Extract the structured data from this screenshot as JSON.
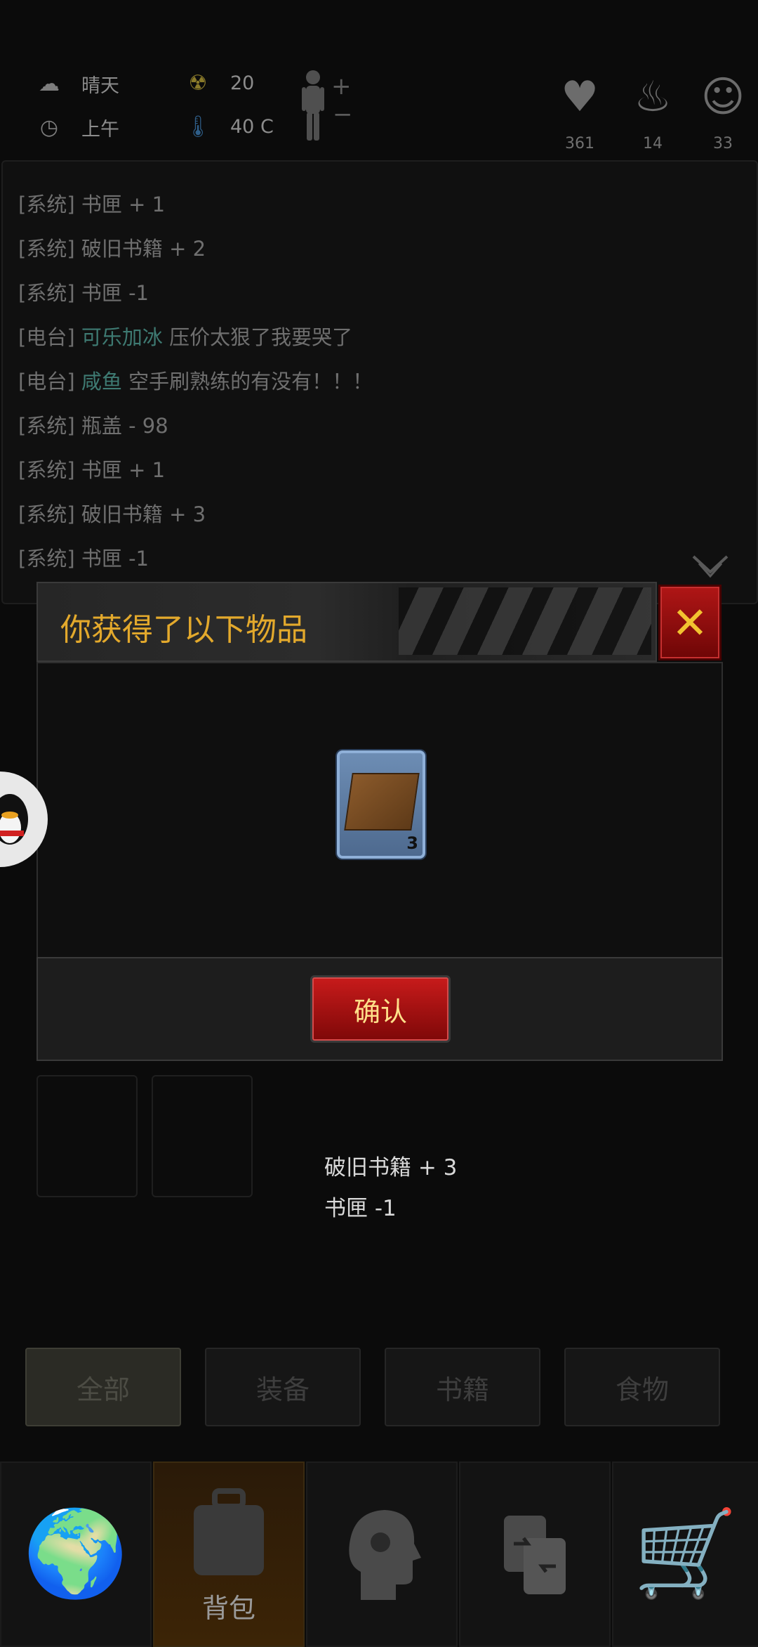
{
  "status": {
    "weather_label": "晴天",
    "time_label": "上午",
    "radiation_value": "20",
    "temperature_value": "40 C",
    "health_value": "361",
    "stamina_value": "14",
    "mind_value": "33"
  },
  "log": [
    {
      "tag": "[系统]",
      "who": "",
      "text": "书匣 + 1"
    },
    {
      "tag": "[系统]",
      "who": "",
      "text": "破旧书籍 + 2"
    },
    {
      "tag": "[系统]",
      "who": "",
      "text": "书匣 -1"
    },
    {
      "tag": "[电台]",
      "who": "可乐加冰",
      "text": "压价太狠了我要哭了"
    },
    {
      "tag": "[电台]",
      "who": "咸鱼",
      "text": "空手刷熟练的有没有！！！"
    },
    {
      "tag": "[系统]",
      "who": "",
      "text": "瓶盖 - 98"
    },
    {
      "tag": "[系统]",
      "who": "",
      "text": "书匣 + 1"
    },
    {
      "tag": "[系统]",
      "who": "",
      "text": "破旧书籍 + 3"
    },
    {
      "tag": "[系统]",
      "who": "",
      "text": "书匣 -1"
    }
  ],
  "modal": {
    "title": "你获得了以下物品",
    "item_count": "3",
    "confirm_label": "确认"
  },
  "results": [
    "破旧书籍 + 3",
    "书匣 -1"
  ],
  "filters": [
    "全部",
    "装备",
    "书籍",
    "食物"
  ],
  "nav": {
    "bag_label": "背包"
  },
  "icons": {
    "weather": "cloud-sun-icon",
    "clock": "clock-icon",
    "radiation": "radiation-icon",
    "thermometer": "thermometer-icon",
    "health": "heart-icon",
    "stamina": "steam-icon",
    "mind": "brain-head-icon"
  },
  "colors": {
    "title_gold": "#e3a92c",
    "confirm_red": "#c81b1b",
    "close_red": "#b01616",
    "slot_blue": "#6d8db4"
  }
}
